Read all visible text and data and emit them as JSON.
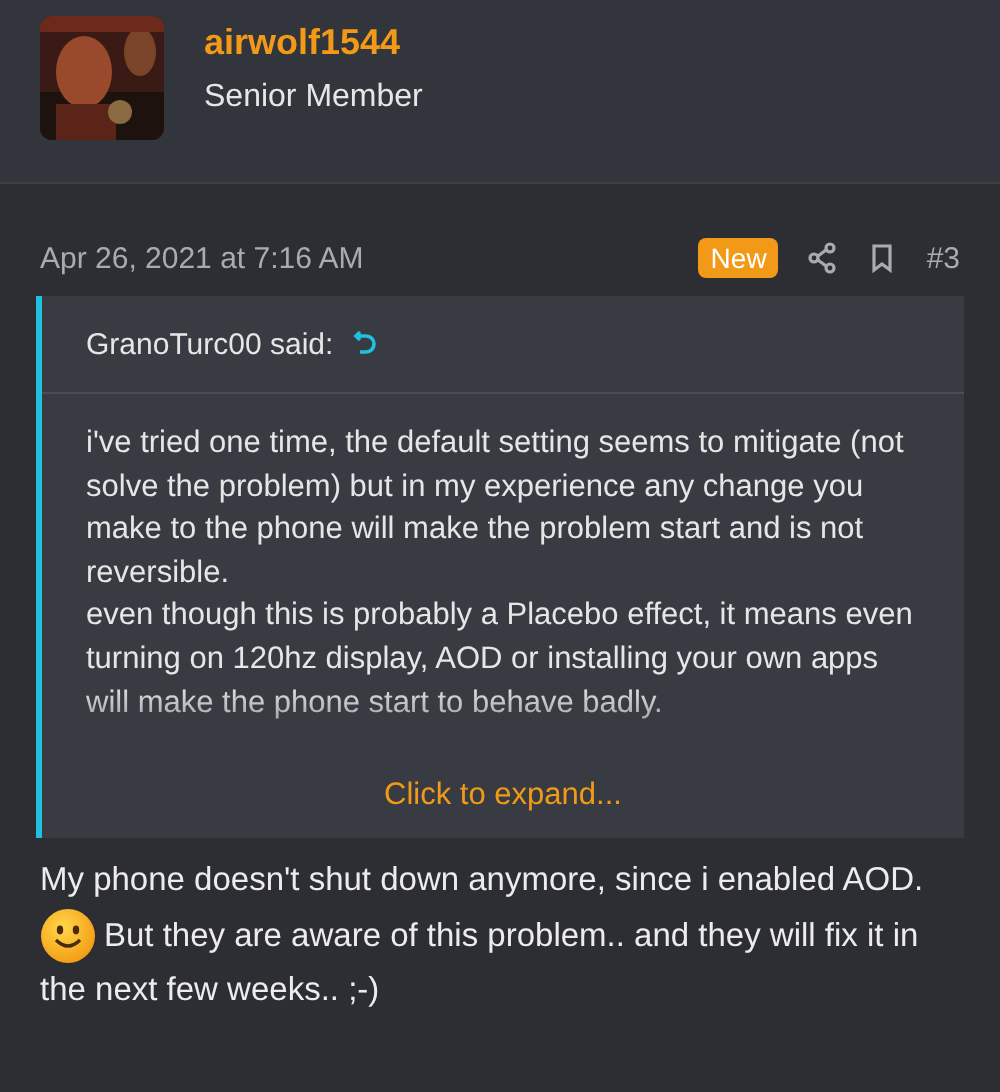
{
  "author": {
    "name": "airwolf1544",
    "title": "Senior Member"
  },
  "post_meta": {
    "date": "Apr 26, 2021 at 7:16 AM",
    "badge": "New",
    "post_number": "#3"
  },
  "quote": {
    "attribution": "GranoTurc00 said:",
    "lines": [
      "i've tried one time, the default setting seems to mitigate (not solve the problem) but in my experience any change you make to the phone will make the problem start and is not reversible.",
      "even though this is probably a Placebo effect, it means even turning on 120hz display, AOD or installing your own apps will make the phone start to behave badly."
    ],
    "expand_link": "Click to expand..."
  },
  "message": {
    "before_emoji": "My phone doesn't shut down anymore, since i enabled AOD.",
    "after_emoji_lines": [
      "But they are aware of this problem.. and they will fix it in",
      "the next few weeks.. ;-)"
    ]
  }
}
